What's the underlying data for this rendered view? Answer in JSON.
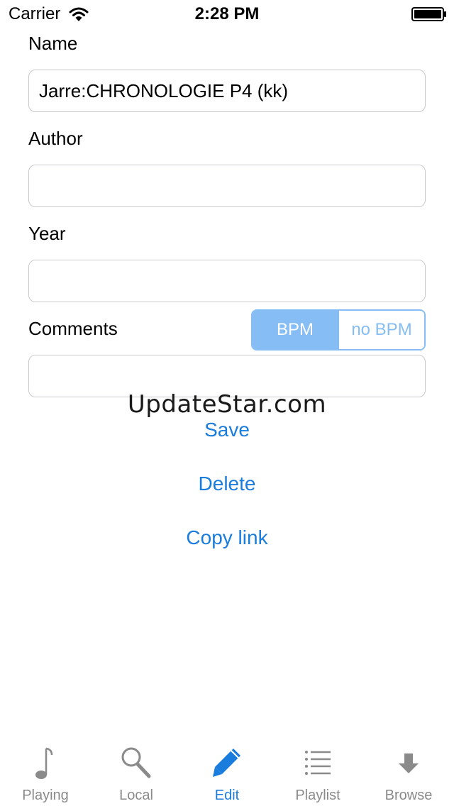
{
  "status_bar": {
    "carrier": "Carrier",
    "time": "2:28 PM"
  },
  "form": {
    "name": {
      "label": "Name",
      "value": "Jarre:CHRONOLOGIE P4 (kk)"
    },
    "author": {
      "label": "Author",
      "value": ""
    },
    "year": {
      "label": "Year",
      "value": ""
    },
    "comments": {
      "label": "Comments",
      "value": ""
    },
    "bpm_toggle": {
      "options": [
        "BPM",
        "no BPM"
      ],
      "selected": "BPM"
    }
  },
  "watermark": "UpdateStar.com",
  "actions": {
    "save": "Save",
    "delete": "Delete",
    "copy_link": "Copy link"
  },
  "tab_bar": {
    "items": [
      {
        "label": "Playing",
        "icon": "music-note-icon"
      },
      {
        "label": "Local",
        "icon": "search-icon"
      },
      {
        "label": "Edit",
        "icon": "pencil-icon"
      },
      {
        "label": "Playlist",
        "icon": "list-icon"
      },
      {
        "label": "Browse",
        "icon": "download-arrow-icon"
      }
    ],
    "active": "Edit"
  },
  "colors": {
    "accent": "#1a7cdc",
    "segment_selected": "#86bdf5",
    "inactive_tab": "#8a8a8a",
    "field_border": "#c9c9ce"
  }
}
